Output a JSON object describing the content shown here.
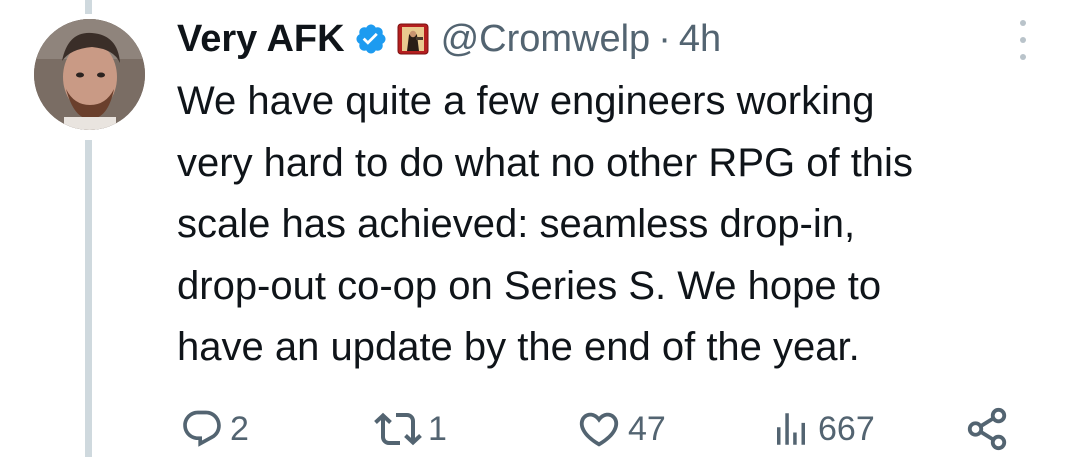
{
  "tweet": {
    "author_name": "Very AFK",
    "handle": "@Cromwelp",
    "separator": "·",
    "time": "4h",
    "text_lines": [
      "We have quite a few engineers working",
      "very hard to do what no other RPG of this",
      "scale has achieved: seamless drop-in,",
      "drop-out co-op on Series S. We hope to",
      "have an update by the end of the year."
    ]
  },
  "actions": {
    "replies": "2",
    "retweets": "1",
    "likes": "47",
    "views": "667"
  },
  "colors": {
    "text": "#0f1419",
    "secondary": "#536471",
    "verified": "#1d9bf0",
    "thread_line": "#cfd9de"
  },
  "icons": [
    "verified-badge-icon",
    "affiliate-badge-icon",
    "more-options-icon",
    "reply-icon",
    "retweet-icon",
    "like-icon",
    "views-icon",
    "share-icon"
  ]
}
